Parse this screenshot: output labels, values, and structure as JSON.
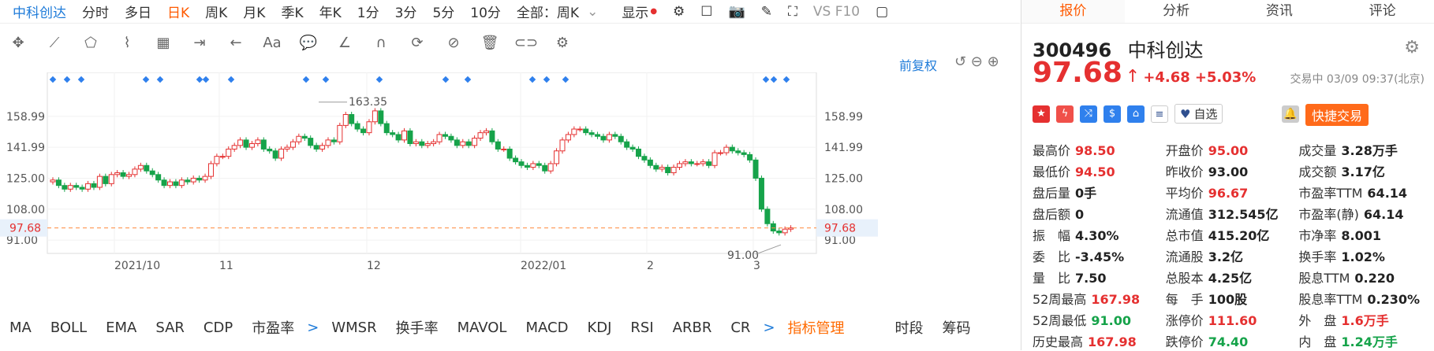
{
  "topbar": {
    "stock": "中科创达",
    "tabs": [
      "分时",
      "多日",
      "日K",
      "周K",
      "月K",
      "季K",
      "年K",
      "1分",
      "3分",
      "5分",
      "10分"
    ],
    "active": "日K",
    "range": "全部：周K",
    "display": "显示",
    "vs": "VS F10"
  },
  "chart": {
    "adjust": "前复权",
    "yticks": [
      "158.99",
      "141.99",
      "125.00",
      "108.00",
      "91.00"
    ],
    "current": "97.68",
    "high_label": "163.35",
    "low_label": "91.00",
    "xticks": [
      "2021/10",
      "11",
      "12",
      "2022/01",
      "2",
      "3"
    ]
  },
  "chart_data": {
    "type": "candlestick",
    "title": "",
    "xlabel": "",
    "ylabel": "",
    "ylim": [
      91.0,
      168.0
    ],
    "ticks_y": [
      158.99,
      141.99,
      125.0,
      108.0,
      91.0
    ],
    "x_ticks": [
      "2021/10",
      "11",
      "12",
      "2022/01",
      "2",
      "3"
    ],
    "closes": [
      124,
      121,
      119,
      121,
      120,
      119,
      122,
      120,
      126,
      122,
      127,
      128,
      126,
      127,
      130,
      132,
      129,
      127,
      124,
      121,
      123,
      121,
      124,
      123,
      125,
      124,
      126,
      133,
      137,
      137,
      141,
      143,
      146,
      142,
      144,
      146,
      141,
      140,
      136,
      141,
      142,
      145,
      148,
      147,
      143,
      141,
      143,
      146,
      145,
      154,
      160,
      155,
      152,
      150,
      156,
      162,
      155,
      150,
      149,
      146,
      151,
      144,
      145,
      143,
      144,
      145,
      149,
      148,
      146,
      143,
      145,
      143,
      147,
      150,
      151,
      145,
      141,
      141,
      136,
      134,
      132,
      131,
      133,
      132,
      129,
      133,
      140,
      146,
      149,
      152,
      152,
      150,
      149,
      148,
      146,
      149,
      148,
      145,
      142,
      141,
      137,
      135,
      132,
      130,
      131,
      128,
      131,
      133,
      134,
      133,
      133,
      134,
      132,
      139,
      139,
      142,
      140,
      139,
      138,
      135,
      125,
      108,
      100,
      96,
      95,
      97,
      97.68
    ],
    "current": 97.68,
    "high": 163.35,
    "low": 91.0
  },
  "toolbar": {
    "icons": [
      "move-icon",
      "line-icon",
      "polyline-icon",
      "wave-icon",
      "fib-icon",
      "range-icon",
      "arrow-icon",
      "text-icon",
      "comment-icon",
      "angle-icon",
      "arc-icon",
      "cycle-icon",
      "hide-icon",
      "delete-icon",
      "compare-icon",
      "settings-icon"
    ],
    "text": "Aa"
  },
  "indicators": [
    "MA",
    "BOLL",
    "EMA",
    "SAR",
    "CDP",
    "市盈率",
    ">",
    "WMSR",
    "换手率",
    "MAVOL",
    "MACD",
    "KDJ",
    "RSI",
    "ARBR",
    "CR",
    ">",
    "指标管理",
    "时段",
    "筹码"
  ],
  "right": {
    "tabs": [
      "报价",
      "分析",
      "资讯",
      "评论"
    ],
    "active": "报价",
    "code": "300496",
    "name": "中科创达",
    "price": "97.68",
    "change": "+4.68",
    "pct": "+5.03%",
    "status": "交易中 03/09 09:37(北京)",
    "zixuan": "自选",
    "quick": "快捷交易",
    "rows": [
      [
        [
          "最高价",
          "98.50",
          "red"
        ],
        [
          "开盘价",
          "95.00",
          "red"
        ],
        [
          "成交量",
          "3.28万手",
          ""
        ]
      ],
      [
        [
          "最低价",
          "94.50",
          "red"
        ],
        [
          "昨收价",
          "93.00",
          ""
        ],
        [
          "成交额",
          "3.17亿",
          ""
        ]
      ],
      [
        [
          "盘后量",
          "0手",
          ""
        ],
        [
          "平均价",
          "96.67",
          "red"
        ],
        [
          "市盈率TTM",
          "64.14",
          ""
        ]
      ],
      [
        [
          "盘后额",
          "0",
          ""
        ],
        [
          "流通值",
          "312.545亿",
          ""
        ],
        [
          "市盈率(静)",
          "64.14",
          ""
        ]
      ],
      [
        [
          "振　幅",
          "4.30%",
          ""
        ],
        [
          "总市值",
          "415.20亿",
          ""
        ],
        [
          "市净率",
          "8.001",
          ""
        ]
      ],
      [
        [
          "委　比",
          "-3.45%",
          ""
        ],
        [
          "流通股",
          "3.2亿",
          ""
        ],
        [
          "换手率",
          "1.02%",
          ""
        ]
      ],
      [
        [
          "量　比",
          "7.50",
          ""
        ],
        [
          "总股本",
          "4.25亿",
          ""
        ],
        [
          "股息TTM",
          "0.220",
          ""
        ]
      ],
      [
        [
          "52周最高",
          "167.98",
          "red"
        ],
        [
          "每　手",
          "100股",
          ""
        ],
        [
          "股息率TTM",
          "0.230%",
          ""
        ]
      ],
      [
        [
          "52周最低",
          "91.00",
          "green"
        ],
        [
          "涨停价",
          "111.60",
          "red"
        ],
        [
          "外　盘",
          "1.6万手",
          "red"
        ]
      ],
      [
        [
          "历史最高",
          "167.98",
          "red"
        ],
        [
          "跌停价",
          "74.40",
          "green"
        ],
        [
          "内　盘",
          "1.24万手",
          "green"
        ]
      ]
    ]
  }
}
